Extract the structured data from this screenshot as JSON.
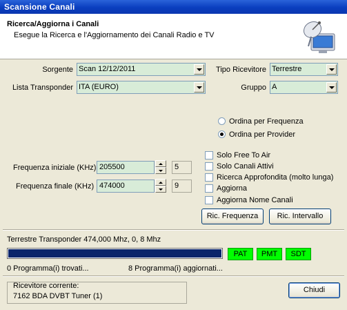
{
  "window": {
    "title": "Scansione Canali"
  },
  "header": {
    "title": "Ricerca/Aggiorna i Canali",
    "subtitle": "Esegue la Ricerca e l'Aggiornamento dei Canali Radio e TV"
  },
  "form": {
    "sorgente": {
      "label": "Sorgente",
      "value": "Scan 12/12/2011"
    },
    "lista_transponder": {
      "label": "Lista Transponder",
      "value": "ITA (EURO)"
    },
    "tipo_ricevitore": {
      "label": "Tipo Ricevitore",
      "value": "Terrestre"
    },
    "gruppo": {
      "label": "Gruppo",
      "value": "A"
    }
  },
  "order": {
    "frequenza": {
      "label": "Ordina per Frequenza",
      "selected": false
    },
    "provider": {
      "label": "Ordina per Provider",
      "selected": true
    }
  },
  "options": [
    {
      "label": "Solo Free To Air",
      "checked": false
    },
    {
      "label": "Solo Canali Attivi",
      "checked": false
    },
    {
      "label": "Ricerca Approfondita (molto lunga)",
      "checked": false
    },
    {
      "label": "Aggiorna",
      "checked": false
    },
    {
      "label": "Aggiorna Nome Canali",
      "checked": false
    }
  ],
  "frequency": {
    "start": {
      "label": "Frequenza iniziale (KHz)",
      "value": "205500",
      "index": "5"
    },
    "end": {
      "label": "Frequenza finale (KHz)",
      "value": "474000",
      "index": "9"
    }
  },
  "buttons": {
    "ric_frequenza": "Ric. Frequenza",
    "ric_intervallo": "Ric. Intervallo",
    "chiudi": "Chiudi"
  },
  "status": {
    "transponder": "Terrestre Transponder 474,000 Mhz, 0, 8 Mhz",
    "progress": 1.0,
    "tags": [
      "PAT",
      "PMT",
      "SDT"
    ],
    "found": "0 Programma(i) trovati...",
    "updated": "8 Programma(i) aggiornati..."
  },
  "receiver": {
    "label": "Ricevitore corrente:",
    "value": "7162 BDA DVBT Tuner (1)"
  },
  "colors": {
    "progress_fill": "#0a246a",
    "tag_bg": "#00ff00",
    "field_bg": "#d8ecd8"
  }
}
